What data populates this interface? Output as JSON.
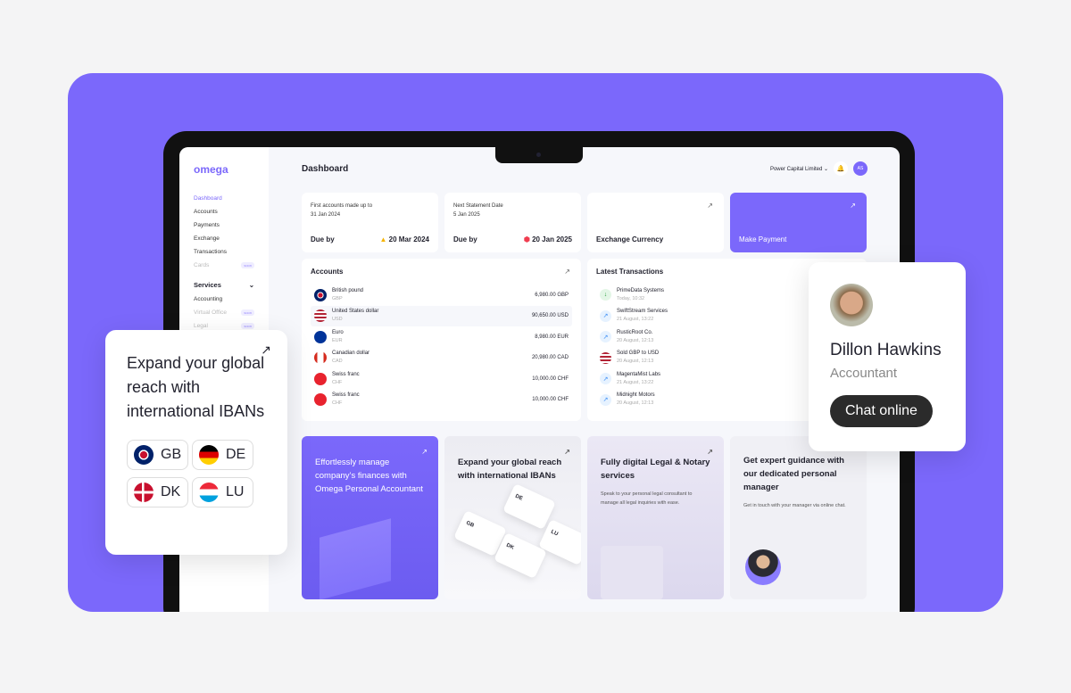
{
  "brand": "omega",
  "sidebar": {
    "items": [
      {
        "label": "Dashboard",
        "active": true
      },
      {
        "label": "Accounts"
      },
      {
        "label": "Payments"
      },
      {
        "label": "Exchange"
      },
      {
        "label": "Transactions"
      },
      {
        "label": "Cards",
        "badge": "soon"
      }
    ],
    "services_label": "Services",
    "services": [
      {
        "label": "Accounting"
      },
      {
        "label": "Virtual Office",
        "badge": "soon"
      },
      {
        "label": "Legal",
        "badge": "soon"
      }
    ]
  },
  "header": {
    "title": "Dashboard",
    "company": "Power Capital Limited",
    "avatar": "AS"
  },
  "summary": [
    {
      "label": "First accounts made up to",
      "date": "31 Jan 2024",
      "due_label": "Due by",
      "due": "20 Mar 2024",
      "status": "warning"
    },
    {
      "label": "Next Statement Date",
      "date": "5 Jan 2025",
      "due_label": "Due by",
      "due": "20 Jan 2025",
      "status": "overdue"
    }
  ],
  "actions": {
    "exchange": "Exchange Currency",
    "payment": "Make Payment"
  },
  "accounts": {
    "title": "Accounts",
    "items": [
      {
        "name": "British pound",
        "code": "GBP",
        "amount": "6,980.00 GBP"
      },
      {
        "name": "United States dollar",
        "code": "USD",
        "amount": "90,650.00 USD"
      },
      {
        "name": "Euro",
        "code": "EUR",
        "amount": "8,980.00 EUR"
      },
      {
        "name": "Canadian dollar",
        "code": "CAD",
        "amount": "20,980.00 CAD"
      },
      {
        "name": "Swiss franc",
        "code": "CHF",
        "amount": "10,000.00 CHF"
      },
      {
        "name": "Swiss franc",
        "code": "CHF",
        "amount": "10,000.00 CHF"
      }
    ]
  },
  "transactions": {
    "title": "Latest Transactions",
    "items": [
      {
        "name": "PrimeData Systems",
        "time": "Today, 10:32"
      },
      {
        "name": "SwiftStream Services",
        "time": "21 August, 13:22"
      },
      {
        "name": "RusticRoot Co.",
        "time": "20 August, 12:13"
      },
      {
        "name": "Sold GBP to USD",
        "time": "20 August, 12:13"
      },
      {
        "name": "MagentaMist Labs",
        "time": "21 August, 13:22"
      },
      {
        "name": "Midnight Motors",
        "time": "20 August, 12:13"
      }
    ]
  },
  "promos": [
    {
      "title": "Effortlessly manage company’s finances with Omega Personal Accountant"
    },
    {
      "title": "Expand your global reach with international IBANs",
      "cards": [
        "DE",
        "GB",
        "LU",
        "DK"
      ]
    },
    {
      "title": "Fully digital Legal & Notary services",
      "text": "Speak to your personal legal consultant to manage all legal inquiries with ease."
    },
    {
      "title": "Get expert guidance with our dedicated personal manager",
      "text": "Get in touch with your manager via online chat."
    }
  ],
  "iban_card": {
    "title": "Expand your global reach with international IBANs",
    "countries": [
      "GB",
      "DE",
      "DK",
      "LU"
    ]
  },
  "contact": {
    "name": "Dillon Hawkins",
    "role": "Accountant",
    "button": "Chat online"
  },
  "colors": {
    "accent": "#7b68fb"
  }
}
